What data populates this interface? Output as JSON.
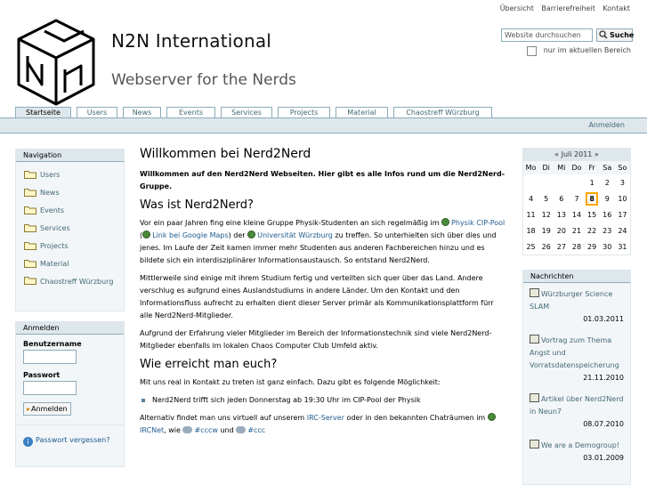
{
  "site_actions": [
    "Übersicht",
    "Barrierefreiheit",
    "Kontakt"
  ],
  "site": {
    "title": "N2N International",
    "subtitle": "Webserver for the Nerds"
  },
  "search": {
    "placeholder": "Website durchsuchen",
    "button": "Suche",
    "only_current": "nur im aktuellen Bereich"
  },
  "tabs": [
    {
      "label": "Startseite",
      "active": true
    },
    {
      "label": "Users"
    },
    {
      "label": "News"
    },
    {
      "label": "Events"
    },
    {
      "label": "Services"
    },
    {
      "label": "Projects"
    },
    {
      "label": "Material"
    },
    {
      "label": "Chaostreff Würzburg"
    }
  ],
  "personal_bar": {
    "login": "Anmelden"
  },
  "navigation": {
    "title": "Navigation",
    "items": [
      "Users",
      "News",
      "Events",
      "Services",
      "Projects",
      "Material",
      "Chaostreff Würzburg"
    ]
  },
  "login_portlet": {
    "title": "Anmelden",
    "username_label": "Benutzername",
    "password_label": "Passwort",
    "button": "Anmelden",
    "forgot": "Passwort vergessen?"
  },
  "content": {
    "title": "Willkommen bei Nerd2Nerd",
    "lead": "Willkommen auf den Nerd2Nerd Webseiten. Hier gibt es alle Infos rund um die Nerd2Nerd-Gruppe.",
    "h_was": "Was ist Nerd2Nerd?",
    "p1_a": "Vor ein paar Jahren fing eine kleine Gruppe Physik-Studenten an sich regelmäßig im ",
    "link_cip": "Physik CIP-Pool",
    "p1_b": " (",
    "link_maps": "Link bei Google Maps",
    "p1_c": ") der ",
    "link_uni": "Universität Würzburg",
    "p1_d": " zu treffen. So unterhielten sich über dies und jenes. Im Laufe der Zeit kamen immer mehr Studenten aus anderen Fachbereichen hinzu und es bildete sich ein interdisziplinärer Informationsaustausch. So entstand Nerd2Nerd.",
    "p2": "Mittlerweile sind einige mit ihrem Studium fertig und verteilten sich quer über das Land. Andere verschlug es aufgrund eines Auslandstudiums in andere Länder. Um den Kontakt und den Informationsfluss aufrecht zu erhalten dient dieser Server primär als Kommunikationsplattform fürr alle Nerd2Nerd-Mitglieder.",
    "p3": "Aufgrund der Erfahrung vieler Mitglieder im Bereich der Informationstechnik sind viele Nerd2Nerd-Mitglieder ebenfalls im lokalen Chaos Computer Club Umfeld aktiv.",
    "h_wie": "Wie erreicht man euch?",
    "p4": "Mit uns real in Kontakt zu treten ist ganz einfach. Dazu gibt es folgende Möglichkeit:",
    "bullet1": "Nerd2Nerd trifft sich jeden Donnerstag ab 19:30 Uhr im CIP-Pool der Physik",
    "p5_a": "Alternativ findet man uns virtuell auf unserem ",
    "link_irc": "IRC-Server",
    "p5_b": " oder in den bekannten Chaträumen im ",
    "link_ircnet": "IRCNet",
    "p5_c": ", wie ",
    "link_cccw": "#cccw",
    "p5_d": " und ",
    "link_ccc": "#ccc"
  },
  "calendar": {
    "title": "« Juli 2011 »",
    "days": [
      "Mo",
      "Di",
      "Mi",
      "Do",
      "Fr",
      "Sa",
      "So"
    ],
    "weeks": [
      [
        "",
        "",
        "",
        "",
        "1",
        "2",
        "3"
      ],
      [
        "4",
        "5",
        "6",
        "7",
        "8",
        "9",
        "10"
      ],
      [
        "11",
        "12",
        "13",
        "14",
        "15",
        "16",
        "17"
      ],
      [
        "18",
        "19",
        "20",
        "21",
        "22",
        "23",
        "24"
      ],
      [
        "25",
        "26",
        "27",
        "28",
        "29",
        "30",
        "31"
      ]
    ],
    "today": "8"
  },
  "news": {
    "title": "Nachrichten",
    "items": [
      {
        "title": "Würzburger Science SLAM",
        "date": "01.03.2011"
      },
      {
        "title": "Vortrag zum Thema Angst und Vorratsdatenspeicherung",
        "date": "21.11.2010"
      },
      {
        "title": "Artikel über Nerd2Nerd in Neun7",
        "date": "08.07.2010"
      },
      {
        "title": "We are a Demogroup!",
        "date": "03.01.2009"
      }
    ]
  },
  "colors": {
    "accent_border": "#8cacbb",
    "tab_bg": "#dee7ec",
    "link": "#436976"
  }
}
